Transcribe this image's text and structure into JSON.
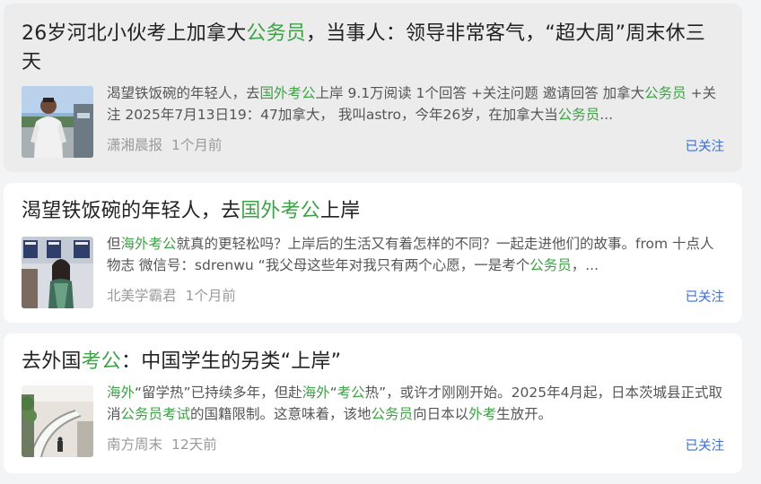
{
  "items": [
    {
      "title": [
        {
          "t": "26岁河北小伙考上加拿大",
          "hl": false
        },
        {
          "t": "公务员",
          "hl": true
        },
        {
          "t": "，当事人：领导非常客气，“超大周”周末休三天",
          "hl": false
        }
      ],
      "abstract": [
        {
          "t": "渴望铁饭碗的年轻人，去",
          "hl": false
        },
        {
          "t": "国外考公",
          "hl": true
        },
        {
          "t": "上岸 9.1万阅读 1个回答 +关注问题 邀请回答 加拿大",
          "hl": false
        },
        {
          "t": "公务员",
          "hl": true
        },
        {
          "t": " +关注 2025年7月13日19：47加拿大， 我叫astro，今年26岁，在加拿大当",
          "hl": false
        },
        {
          "t": "公务员",
          "hl": true
        },
        {
          "t": "...",
          "hl": false
        }
      ],
      "source": "潇湘晨报",
      "time": "1个月前",
      "follow_label": "已关注"
    },
    {
      "title": [
        {
          "t": "渴望铁饭碗的年轻人，去",
          "hl": false
        },
        {
          "t": "国外考公",
          "hl": true
        },
        {
          "t": "上岸",
          "hl": false
        }
      ],
      "abstract": [
        {
          "t": "但",
          "hl": false
        },
        {
          "t": "海外考公",
          "hl": true
        },
        {
          "t": "就真的更轻松吗？上岸后的生活又有着怎样的不同？一起走进他们的故事。from 十点人物志 微信号：sdrenwu “我父母这些年对我只有两个心愿，一是考个",
          "hl": false
        },
        {
          "t": "公务员",
          "hl": true
        },
        {
          "t": "，...",
          "hl": false
        }
      ],
      "source": "北美学霸君",
      "time": "1个月前",
      "follow_label": "已关注"
    },
    {
      "title": [
        {
          "t": "去外国",
          "hl": false
        },
        {
          "t": "考公",
          "hl": true
        },
        {
          "t": "：中国学生的另类“上岸”",
          "hl": false
        }
      ],
      "abstract": [
        {
          "t": "海外",
          "hl": true
        },
        {
          "t": "“留学热”已持续多年，但赴",
          "hl": false
        },
        {
          "t": "海外",
          "hl": true
        },
        {
          "t": "“",
          "hl": false
        },
        {
          "t": "考公",
          "hl": true
        },
        {
          "t": "热”，或许才刚刚开始。2025年4月起，日本茨城县正式取消",
          "hl": false
        },
        {
          "t": "公务员考试",
          "hl": true
        },
        {
          "t": "的国籍限制。这意味着，该地",
          "hl": false
        },
        {
          "t": "公务员",
          "hl": true
        },
        {
          "t": "向日本以",
          "hl": false
        },
        {
          "t": "外考",
          "hl": true
        },
        {
          "t": "生放开。",
          "hl": false
        }
      ],
      "source": "南方周末",
      "time": "12天前",
      "follow_label": "已关注"
    }
  ],
  "colors": {
    "highlight": "#3fa147",
    "follow": "#3b6fd4",
    "meta": "#9a9a9a",
    "hover_card": "#ececec"
  }
}
